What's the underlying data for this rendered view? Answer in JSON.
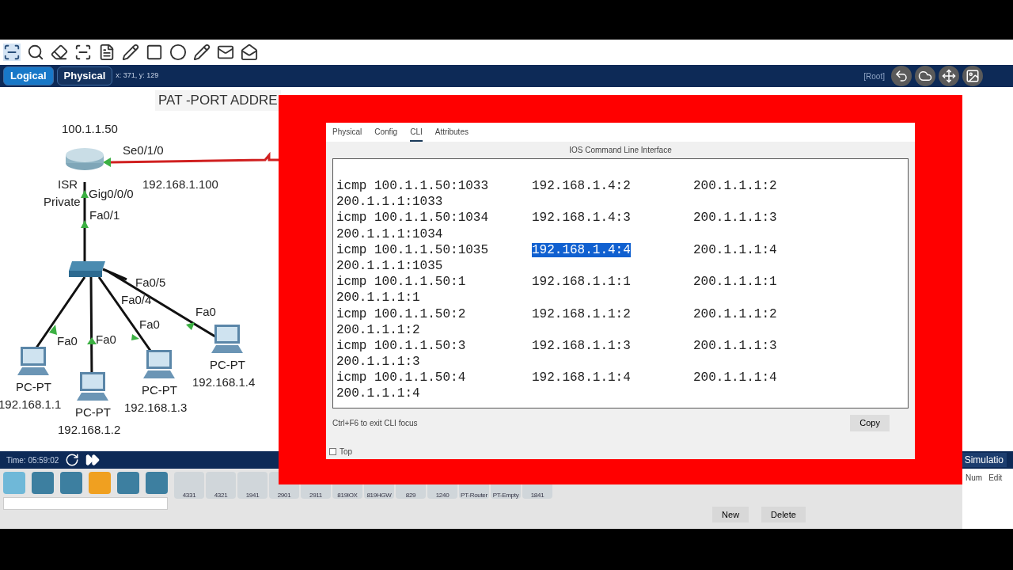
{
  "view_tabs": [
    {
      "label": "Logical",
      "selected": true
    },
    {
      "label": "Physical",
      "selected": false
    }
  ],
  "cursor_position": "x: 371, y: 129",
  "root_label": "[Root]",
  "canvas": {
    "title": "PAT -PORT ADDRE",
    "labels": [
      "100.1.1.50",
      "Se0/1/0",
      "192.168.1.100",
      "ISR",
      "Gig0/0/0",
      "Private",
      "Fa0/1",
      "Fa0/5",
      "Fa0/4",
      "Fa0",
      "Fa0",
      "Fa0",
      "Fa0"
    ],
    "pcs": [
      {
        "name": "PC-PT",
        "ip": "192.168.1.1"
      },
      {
        "name": "PC-PT",
        "ip": "192.168.1.2"
      },
      {
        "name": "PC-PT",
        "ip": "192.168.1.3"
      },
      {
        "name": "PC-PT",
        "ip": "192.168.1.4"
      }
    ]
  },
  "dialog": {
    "tabs": [
      {
        "label": "Physical",
        "selected": false
      },
      {
        "label": "Config",
        "selected": false
      },
      {
        "label": "CLI",
        "selected": true
      },
      {
        "label": "Attributes",
        "selected": false
      }
    ],
    "heading": "IOS Command Line Interface",
    "lines": [
      {
        "cells": [
          "icmp 100.1.1.50:1033",
          "192.168.1.4:2",
          "200.1.1.1:2"
        ],
        "highlighted": false
      },
      {
        "cells": [
          "200.1.1.1:1033"
        ],
        "highlighted": false
      },
      {
        "cells": [
          "icmp 100.1.1.50:1034",
          "192.168.1.4:3",
          "200.1.1.1:3"
        ],
        "highlighted": false
      },
      {
        "cells": [
          "200.1.1.1:1034"
        ],
        "highlighted": false
      },
      {
        "cells": [
          "icmp 100.1.1.50:1035",
          "192.168.1.4:4",
          "200.1.1.1:4"
        ],
        "highlighted": true
      },
      {
        "cells": [
          "200.1.1.1:1035"
        ],
        "highlighted": false
      },
      {
        "cells": [
          "icmp 100.1.1.50:1",
          "192.168.1.1:1",
          "200.1.1.1:1"
        ],
        "highlighted": false
      },
      {
        "cells": [
          "200.1.1.1:1"
        ],
        "highlighted": false
      },
      {
        "cells": [
          "icmp 100.1.1.50:2",
          "192.168.1.1:2",
          "200.1.1.1:2"
        ],
        "highlighted": false
      },
      {
        "cells": [
          "200.1.1.1:2"
        ],
        "highlighted": false
      },
      {
        "cells": [
          "icmp 100.1.1.50:3",
          "192.168.1.1:3",
          "200.1.1.1:3"
        ],
        "highlighted": false
      },
      {
        "cells": [
          "200.1.1.1:3"
        ],
        "highlighted": false
      },
      {
        "cells": [
          "icmp 100.1.1.50:4",
          "192.168.1.1:4",
          "200.1.1.1:4"
        ],
        "highlighted": false
      },
      {
        "cells": [
          "200.1.1.1:4"
        ],
        "highlighted": false
      }
    ],
    "hint": "Ctrl+F6 to exit CLI focus",
    "copy_button": "Copy",
    "top_checkbox": {
      "label": "Top",
      "checked": false
    }
  },
  "sim_time": "Time: 05:59:02",
  "devices": [
    "4331",
    "4321",
    "1941",
    "2901",
    "2911",
    "819IOX",
    "819HGW",
    "829",
    "1240",
    "PT-Router",
    "PT-Empty",
    "1841"
  ],
  "pdu_buttons": [
    "New",
    "Delete"
  ],
  "mode_label": "Simulatio",
  "menu_items": [
    "Num",
    "Edit"
  ]
}
